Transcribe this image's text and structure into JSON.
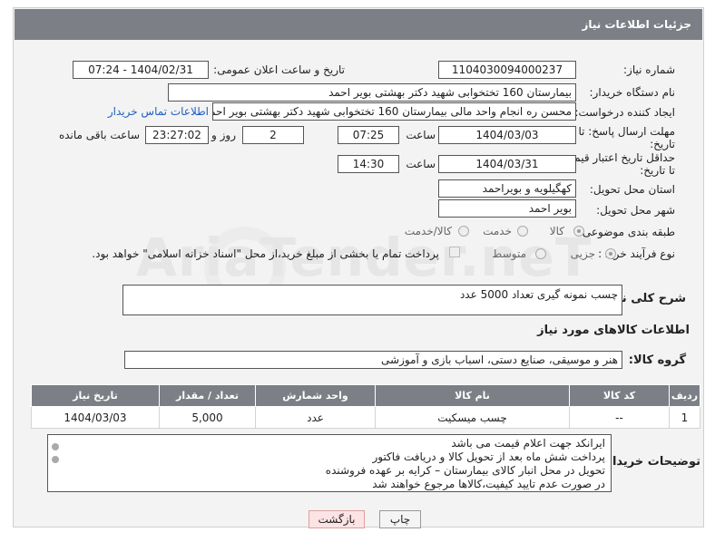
{
  "header": {
    "title": "جزئیات اطلاعات نیاز"
  },
  "fields": {
    "need_number_label": "شماره نیاز:",
    "need_number": "1104030094000237",
    "announce_label": "تاریخ و ساعت اعلان عمومی:",
    "announce_value": "1404/02/31 - 07:24",
    "buyer_org_label": "نام دستگاه خریدار:",
    "buyer_org": "بیمارستان 160 تختخوابی شهید دکتر بهشتی بویر احمد",
    "requester_label": "ایجاد کننده درخواست:",
    "requester": "محسن ره انجام واحد مالی بیمارستان 160 تختخوابی شهید دکتر بهشتی بویر احمد",
    "contact_link": "اطلاعات تماس خریدار",
    "reply_deadline_label": "مهلت ارسال پاسخ: تا تاریخ:",
    "reply_date": "1404/03/03",
    "time_label": "ساعت",
    "reply_time": "07:25",
    "days_value": "2",
    "days_label": "روز و",
    "remaining_value": "23:27:02",
    "remaining_label": "ساعت باقی مانده",
    "price_valid_label": "حداقل تاریخ اعتبار قیمت: تا تاریخ:",
    "price_date": "1404/03/31",
    "price_time": "14:30",
    "province_label": "استان محل تحویل:",
    "province": "کهگیلویه و بویراحمد",
    "city_label": "شهر محل تحویل:",
    "city": "بویر احمد",
    "category_label": "طبقه بندی موضوعی:",
    "cat_goods": "کالا",
    "cat_service": "خدمت",
    "cat_both": "کالا/خدمت",
    "process_label": "نوع فرآیند خرید :",
    "proc_minor": "جزیی",
    "proc_medium": "متوسط",
    "treasury_note": "پرداخت تمام یا بخشی از مبلغ خرید،از محل \"اسناد خزانه اسلامی\" خواهد بود."
  },
  "description": {
    "label": "شرح کلی نیاز:",
    "text": "چسب نمونه گیری تعداد 5000 عدد"
  },
  "goods_section": {
    "title": "اطلاعات کالاهای مورد نیاز",
    "group_label": "گروه کالا:",
    "group_value": "هنر و موسیقی، صنایع دستی، اسباب بازی و آموزشی"
  },
  "table": {
    "headers": [
      "ردیف",
      "کد کالا",
      "نام کالا",
      "واحد شمارش",
      "تعداد / مقدار",
      "تاریخ نیاز"
    ],
    "rows": [
      [
        "1",
        "--",
        "چسب میسکیت",
        "عدد",
        "5,000",
        "1404/03/03"
      ]
    ]
  },
  "notes": {
    "label": "توضیحات خریدار:",
    "lines": [
      "ایرانکد جهت اعلام قیمت می باشد",
      "پرداخت شش ماه بعد از تحویل کالا و دریافت فاکتور",
      "تحویل در محل انبار کالای بیمارستان – کرایه بر عهده فروشنده",
      "در صورت عدم تایید کیفیت،کالاها مرجوع خواهند شد"
    ]
  },
  "buttons": {
    "print": "چاپ",
    "back": "بازگشت"
  },
  "watermark": "AriaTender.neT"
}
